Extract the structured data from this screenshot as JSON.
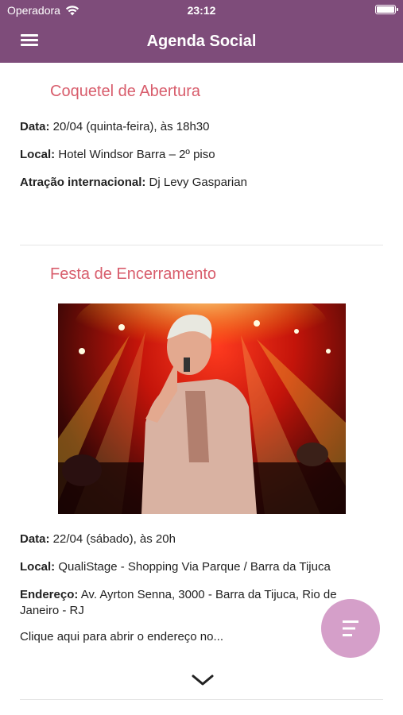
{
  "status": {
    "carrier": "Operadora",
    "time": "23:12"
  },
  "header": {
    "title": "Agenda Social"
  },
  "events": [
    {
      "title": "Coquetel de Abertura",
      "lines": [
        {
          "label": "Data:",
          "value": " 20/04 (quinta-feira), às 18h30"
        },
        {
          "label": "Local:",
          "value": " Hotel Windsor Barra – 2º piso"
        },
        {
          "label": "Atração internacional:",
          "value": " Dj Levy Gasparian"
        }
      ]
    },
    {
      "title": "Festa de Encerramento",
      "lines": [
        {
          "label": "Data:",
          "value": " 22/04 (sábado), às 20h"
        },
        {
          "label": "Local:",
          "value": " QualiStage - Shopping Via Parque / Barra da Tijuca"
        },
        {
          "label": "Endereço:",
          "value": " Av. Ayrton Senna, 3000 - Barra da Tijuca, Rio de Janeiro - RJ"
        }
      ],
      "link_text": "Clique aqui para abrir o endereço no..."
    }
  ],
  "colors": {
    "bar": "#7e4c7a",
    "accent_title": "#d85d6c",
    "fab": "#d59fc9"
  },
  "icons": {
    "menu": "hamburger-menu-icon",
    "fab": "filter-list-icon",
    "expand": "chevron-down-icon"
  }
}
